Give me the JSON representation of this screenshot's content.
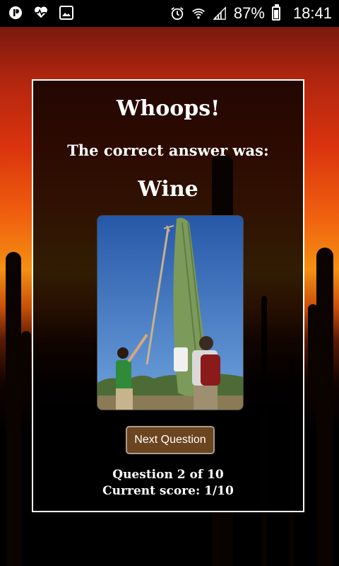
{
  "status_bar": {
    "left_icons": [
      "pushbullet-icon",
      "health-icon",
      "image-icon"
    ],
    "right_icons": [
      "alarm-icon",
      "wifi-icon",
      "signal-icon",
      "battery-icon"
    ],
    "battery_percent": "87%",
    "battery_level": 0.87,
    "time": "18:41"
  },
  "dialog": {
    "title": "Whoops!",
    "subtitle": "The correct answer was:",
    "answer": "Wine",
    "next_button": "Next Question",
    "question_progress": "Question 2 of 10",
    "current_score": "Current score: 1/10"
  },
  "colors": {
    "button_bg": "#6b4420",
    "button_border": "#a99c8b",
    "card_border": "#ffffff",
    "sky_orange": "#f0600f"
  }
}
